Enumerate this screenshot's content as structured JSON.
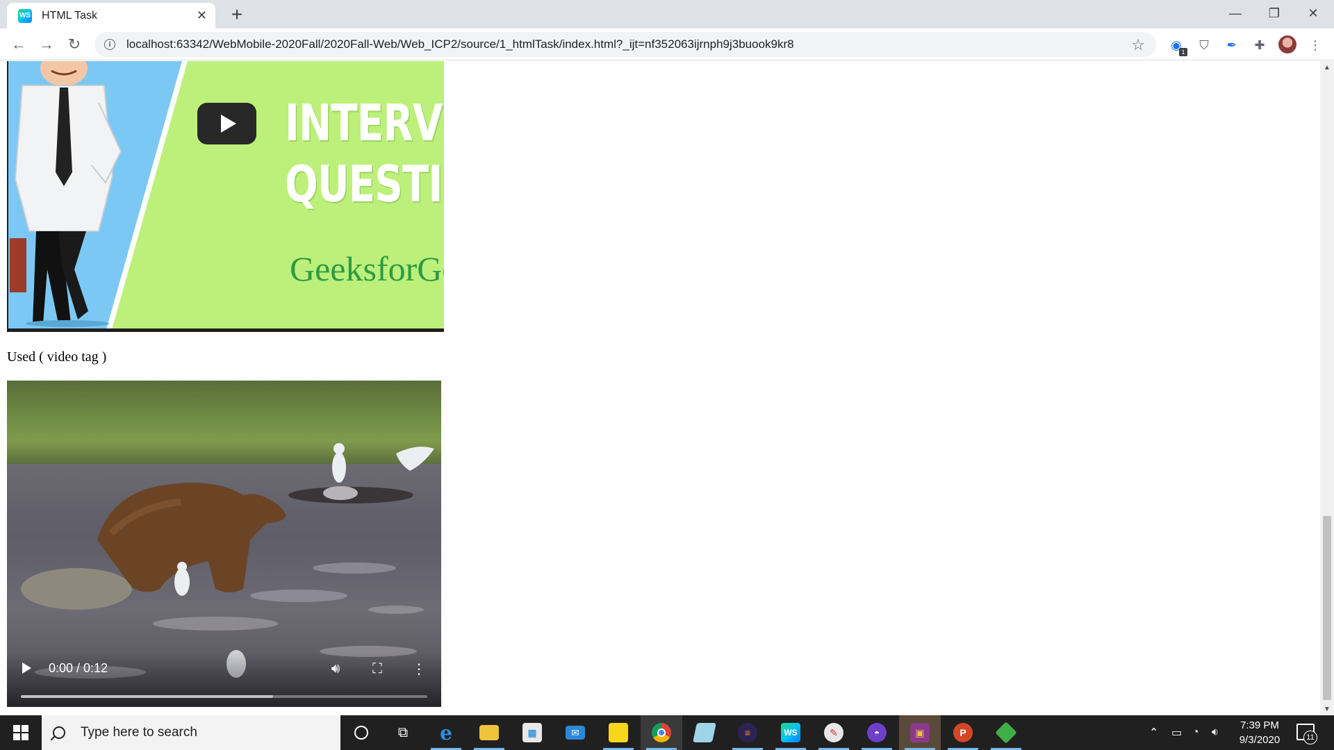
{
  "browser": {
    "tab_title": "HTML Task",
    "tab_icon": "webstorm-icon",
    "url": "localhost:63342/WebMobile-2020Fall/2020Fall-Web/Web_ICP2/source/1_htmlTask/index.html?_ijt=nf352063ijrnph9j3buook9kr8",
    "extension_badge": "1"
  },
  "page": {
    "thumbnail": {
      "title_line1": "INTERVI",
      "title_line2": "QUESTIO",
      "brand": "GeeksforGe",
      "brand_color": "#2d9b45",
      "bg_color": "#bdf07a"
    },
    "caption": "Used ( video tag )",
    "video": {
      "time": "0:00 / 0:12",
      "buffered_fraction": 0.62
    }
  },
  "taskbar": {
    "search_placeholder": "Type here to search",
    "time": "7:39 PM",
    "date": "9/3/2020",
    "notification_count": "11"
  }
}
